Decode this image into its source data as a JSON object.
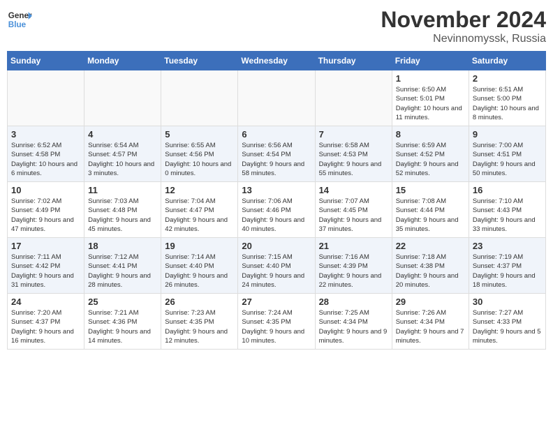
{
  "header": {
    "logo_line1": "General",
    "logo_line2": "Blue",
    "month_title": "November 2024",
    "location": "Nevinnomyssk, Russia"
  },
  "weekdays": [
    "Sunday",
    "Monday",
    "Tuesday",
    "Wednesday",
    "Thursday",
    "Friday",
    "Saturday"
  ],
  "weeks": [
    [
      {
        "day": "",
        "info": ""
      },
      {
        "day": "",
        "info": ""
      },
      {
        "day": "",
        "info": ""
      },
      {
        "day": "",
        "info": ""
      },
      {
        "day": "",
        "info": ""
      },
      {
        "day": "1",
        "info": "Sunrise: 6:50 AM\nSunset: 5:01 PM\nDaylight: 10 hours and 11 minutes."
      },
      {
        "day": "2",
        "info": "Sunrise: 6:51 AM\nSunset: 5:00 PM\nDaylight: 10 hours and 8 minutes."
      }
    ],
    [
      {
        "day": "3",
        "info": "Sunrise: 6:52 AM\nSunset: 4:58 PM\nDaylight: 10 hours and 6 minutes."
      },
      {
        "day": "4",
        "info": "Sunrise: 6:54 AM\nSunset: 4:57 PM\nDaylight: 10 hours and 3 minutes."
      },
      {
        "day": "5",
        "info": "Sunrise: 6:55 AM\nSunset: 4:56 PM\nDaylight: 10 hours and 0 minutes."
      },
      {
        "day": "6",
        "info": "Sunrise: 6:56 AM\nSunset: 4:54 PM\nDaylight: 9 hours and 58 minutes."
      },
      {
        "day": "7",
        "info": "Sunrise: 6:58 AM\nSunset: 4:53 PM\nDaylight: 9 hours and 55 minutes."
      },
      {
        "day": "8",
        "info": "Sunrise: 6:59 AM\nSunset: 4:52 PM\nDaylight: 9 hours and 52 minutes."
      },
      {
        "day": "9",
        "info": "Sunrise: 7:00 AM\nSunset: 4:51 PM\nDaylight: 9 hours and 50 minutes."
      }
    ],
    [
      {
        "day": "10",
        "info": "Sunrise: 7:02 AM\nSunset: 4:49 PM\nDaylight: 9 hours and 47 minutes."
      },
      {
        "day": "11",
        "info": "Sunrise: 7:03 AM\nSunset: 4:48 PM\nDaylight: 9 hours and 45 minutes."
      },
      {
        "day": "12",
        "info": "Sunrise: 7:04 AM\nSunset: 4:47 PM\nDaylight: 9 hours and 42 minutes."
      },
      {
        "day": "13",
        "info": "Sunrise: 7:06 AM\nSunset: 4:46 PM\nDaylight: 9 hours and 40 minutes."
      },
      {
        "day": "14",
        "info": "Sunrise: 7:07 AM\nSunset: 4:45 PM\nDaylight: 9 hours and 37 minutes."
      },
      {
        "day": "15",
        "info": "Sunrise: 7:08 AM\nSunset: 4:44 PM\nDaylight: 9 hours and 35 minutes."
      },
      {
        "day": "16",
        "info": "Sunrise: 7:10 AM\nSunset: 4:43 PM\nDaylight: 9 hours and 33 minutes."
      }
    ],
    [
      {
        "day": "17",
        "info": "Sunrise: 7:11 AM\nSunset: 4:42 PM\nDaylight: 9 hours and 31 minutes."
      },
      {
        "day": "18",
        "info": "Sunrise: 7:12 AM\nSunset: 4:41 PM\nDaylight: 9 hours and 28 minutes."
      },
      {
        "day": "19",
        "info": "Sunrise: 7:14 AM\nSunset: 4:40 PM\nDaylight: 9 hours and 26 minutes."
      },
      {
        "day": "20",
        "info": "Sunrise: 7:15 AM\nSunset: 4:40 PM\nDaylight: 9 hours and 24 minutes."
      },
      {
        "day": "21",
        "info": "Sunrise: 7:16 AM\nSunset: 4:39 PM\nDaylight: 9 hours and 22 minutes."
      },
      {
        "day": "22",
        "info": "Sunrise: 7:18 AM\nSunset: 4:38 PM\nDaylight: 9 hours and 20 minutes."
      },
      {
        "day": "23",
        "info": "Sunrise: 7:19 AM\nSunset: 4:37 PM\nDaylight: 9 hours and 18 minutes."
      }
    ],
    [
      {
        "day": "24",
        "info": "Sunrise: 7:20 AM\nSunset: 4:37 PM\nDaylight: 9 hours and 16 minutes."
      },
      {
        "day": "25",
        "info": "Sunrise: 7:21 AM\nSunset: 4:36 PM\nDaylight: 9 hours and 14 minutes."
      },
      {
        "day": "26",
        "info": "Sunrise: 7:23 AM\nSunset: 4:35 PM\nDaylight: 9 hours and 12 minutes."
      },
      {
        "day": "27",
        "info": "Sunrise: 7:24 AM\nSunset: 4:35 PM\nDaylight: 9 hours and 10 minutes."
      },
      {
        "day": "28",
        "info": "Sunrise: 7:25 AM\nSunset: 4:34 PM\nDaylight: 9 hours and 9 minutes."
      },
      {
        "day": "29",
        "info": "Sunrise: 7:26 AM\nSunset: 4:34 PM\nDaylight: 9 hours and 7 minutes."
      },
      {
        "day": "30",
        "info": "Sunrise: 7:27 AM\nSunset: 4:33 PM\nDaylight: 9 hours and 5 minutes."
      }
    ]
  ]
}
